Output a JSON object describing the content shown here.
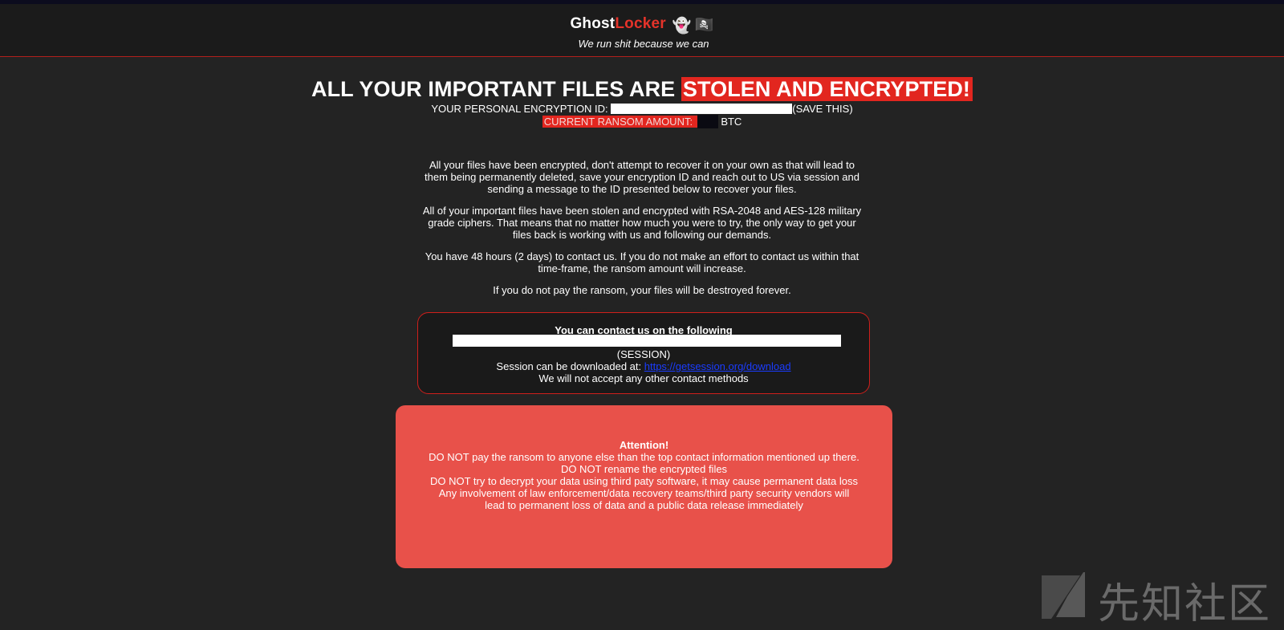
{
  "header": {
    "brand_part1": "Ghost",
    "brand_part2": "Locker",
    "ghost_glyph": "👻",
    "flag_glyph": "🏴‍☠️",
    "tagline": "We run shit because we can"
  },
  "headline": {
    "plain": "ALL YOUR IMPORTANT FILES ARE ",
    "highlight": "STOLEN AND ENCRYPTED!"
  },
  "encryption_id": {
    "label": "YOUR PERSONAL ENCRYPTION ID: ",
    "note": "(SAVE THIS)"
  },
  "ransom": {
    "label": "CURRENT RANSOM AMOUNT: ",
    "currency": "BTC"
  },
  "paragraphs": [
    "All your files have been encrypted, don't attempt to recover it on your own as that will lead to them being permanently deleted, save your encryption ID and reach out to US via session and sending a message to the ID presented below to recover your files.",
    "All of your important files have been stolen and encrypted with RSA-2048 and AES-128 military grade ciphers. That means that no matter how much you were to try, the only way to get your files back is working with us and following our demands.",
    "You have 48 hours (2 days) to contact us. If you do not make an effort to contact us within that time-frame, the ransom amount will increase.",
    "If you do not pay the ransom, your files will be destroyed forever."
  ],
  "contact": {
    "title": "You can contact us on the following",
    "session_label": "(SESSION)",
    "download_prefix": "Session can be downloaded at: ",
    "download_link": "https://getsession.org/download",
    "footer": "We will not accept any other contact methods"
  },
  "attention": {
    "title": "Attention!",
    "lines": [
      "DO NOT pay the ransom to anyone else than the top contact information mentioned up there.",
      "DO NOT rename the encrypted files",
      "DO NOT try to decrypt your data using third paty software, it may cause permanent data loss",
      "Any involvement of law enforcement/data recovery teams/third party security vendors will lead to permanent loss of data and a public data release immediately"
    ]
  },
  "watermark": {
    "text": "先知社区"
  },
  "colors": {
    "background": "#232323",
    "header": "#1b1b1b",
    "accent_red": "#e2261f",
    "attention_box": "#e8514a",
    "link": "#1a3cff"
  }
}
